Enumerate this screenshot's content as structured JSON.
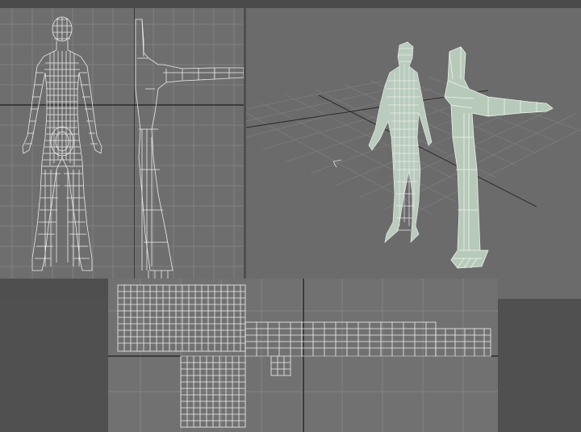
{
  "viewports": [
    {
      "name": "front",
      "background": "#6e6e6e"
    },
    {
      "name": "side",
      "background": "#6e6e6e"
    },
    {
      "name": "perspective",
      "background": "#6b6b6b"
    },
    {
      "name": "uv",
      "background": "#717171"
    }
  ],
  "colors": {
    "grid_line": "#808080",
    "axis_line": "#1e1e1e",
    "wire": "#ececec",
    "mesh_fill": "#b9ccbd",
    "mesh_edge": "#f2f6f2"
  },
  "icons": [
    "axis-gizmo-icon"
  ]
}
